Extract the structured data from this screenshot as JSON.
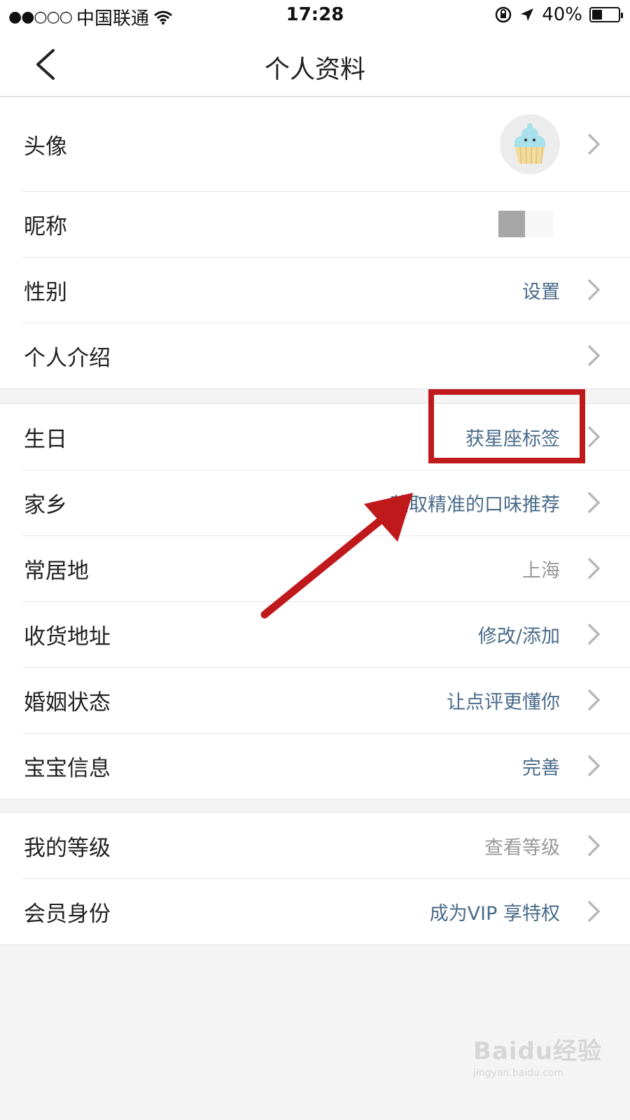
{
  "status_bar": {
    "signal": "●●○○○",
    "carrier": "中国联通",
    "time": "17:28",
    "battery": "40%",
    "battery_level": 0.4
  },
  "nav": {
    "title": "个人资料"
  },
  "rows": {
    "avatar": {
      "label": "头像"
    },
    "nickname": {
      "label": "昵称"
    },
    "gender": {
      "label": "性别",
      "value": "设置"
    },
    "intro": {
      "label": "个人介绍"
    },
    "birthday": {
      "label": "生日",
      "value": "获星座标签"
    },
    "hometown": {
      "label": "家乡",
      "value": "获取精准的口味推荐"
    },
    "residence": {
      "label": "常居地",
      "value": "上海"
    },
    "address": {
      "label": "收货地址",
      "value": "修改/添加"
    },
    "marital": {
      "label": "婚姻状态",
      "value": "让点评更懂你"
    },
    "baby": {
      "label": "宝宝信息",
      "value": "完善"
    },
    "level": {
      "label": "我的等级",
      "value": "查看等级"
    },
    "vip": {
      "label": "会员身份",
      "value": "成为VIP 享特权"
    }
  },
  "watermark": {
    "main": "Baidu经验",
    "sub": "jingyan.baidu.com"
  },
  "colors": {
    "accent_value": "#4a6b8a",
    "gray_value": "#999999",
    "highlight_red": "#c0191c"
  }
}
